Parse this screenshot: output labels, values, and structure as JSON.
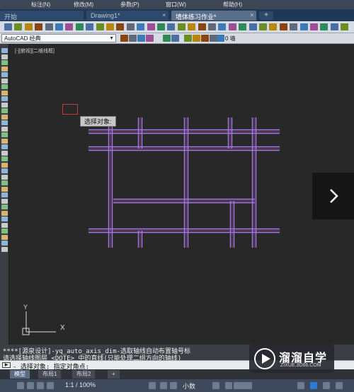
{
  "menu": {
    "items": [
      "标注(N)",
      "修改(M)",
      "参数(P)",
      "窗口(W)",
      "帮助(H)"
    ]
  },
  "tabs": [
    {
      "label": "开始",
      "close": ""
    },
    {
      "label": "Drawing1*",
      "close": "×"
    },
    {
      "label": "墙体练习作业*",
      "close": "×"
    }
  ],
  "new_tab_label": "+",
  "toolbar": {
    "workspace_value": "AutoCAD 经典",
    "layer_value": "0 墙"
  },
  "canvas": {
    "view_label": "[-][俯视][二维线框]",
    "tooltip_text": "选择对象:",
    "ucs_x": "X",
    "ucs_y": "Y"
  },
  "command": {
    "history_1": "****[源泉设计]-yq_auto_axis_dim-选取轴线自动布置轴号标",
    "history_2": "请选择轴线图层 <DOTE> 中的直线(只能处理二组方向的轴线)",
    "prompt": "- 选择对象: 指定对角点:",
    "icon_label": "▶"
  },
  "layout_tabs": [
    "模型",
    "布局1",
    "布局2",
    "+"
  ],
  "status": {
    "scale": "1:1 / 100%",
    "annotation_size": "小数"
  },
  "watermark": {
    "title": "溜溜自学",
    "url": "ZIXUE.3D66.COM"
  },
  "colors": {
    "wall": "#9b7fe0",
    "axis": "#e040e0",
    "canvas_bg": "#282828",
    "accent": "#1f3856"
  },
  "icons": {
    "next": "chevron-right-icon",
    "logo": "play-logo-icon"
  }
}
